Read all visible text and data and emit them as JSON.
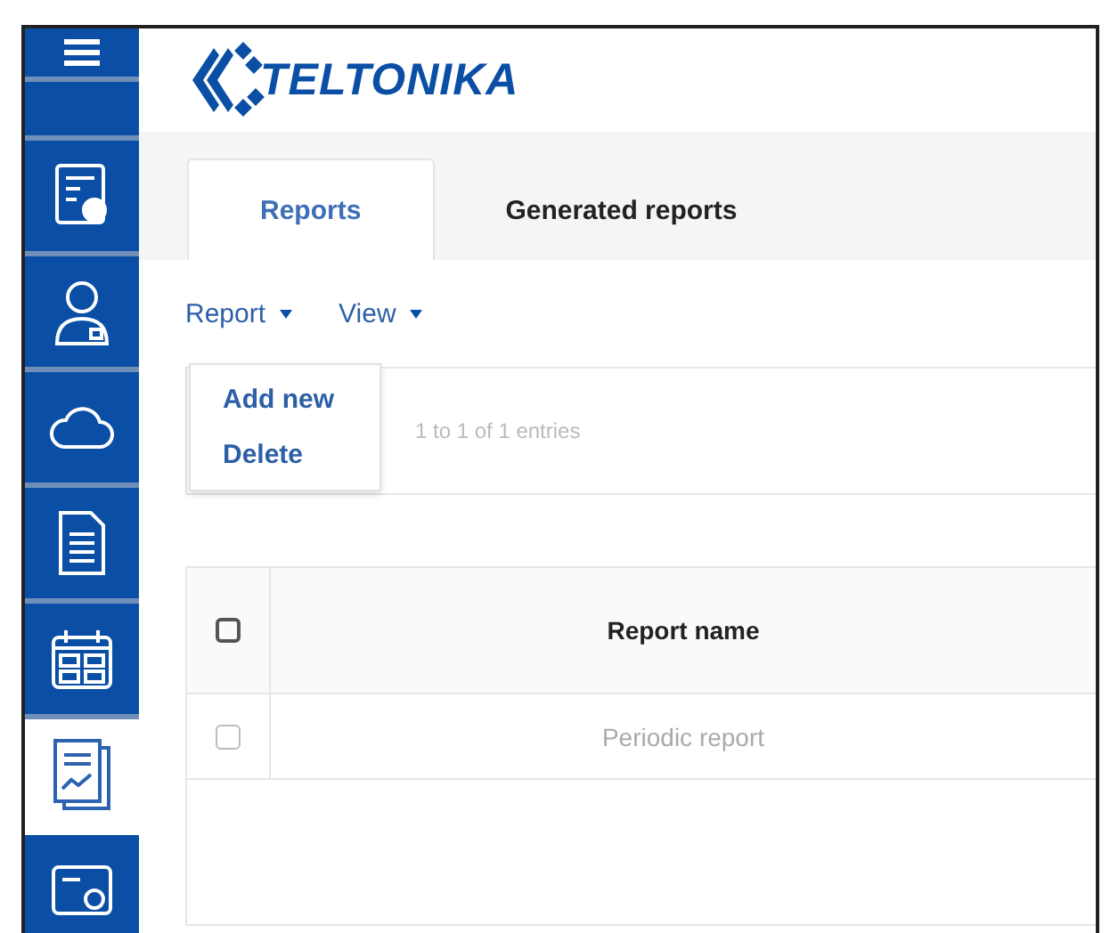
{
  "brand": {
    "name": "TELTONIKA"
  },
  "sidebar": {
    "items": [
      {
        "kind": "settings",
        "selected": false
      },
      {
        "kind": "user",
        "selected": false
      },
      {
        "kind": "cloud",
        "selected": false
      },
      {
        "kind": "document",
        "selected": false
      },
      {
        "kind": "calendar",
        "selected": false
      },
      {
        "kind": "report",
        "selected": true
      },
      {
        "kind": "card",
        "selected": false
      }
    ]
  },
  "tabs": [
    {
      "label": "Reports",
      "selected": true
    },
    {
      "label": "Generated reports",
      "selected": false
    }
  ],
  "toolbar": {
    "menus": [
      {
        "label": "Report",
        "open_items": [
          "Add new",
          "Delete"
        ]
      },
      {
        "label": "View"
      }
    ]
  },
  "info": {
    "text": "1 to 1 of 1 entries"
  },
  "table": {
    "header_checkbox": {
      "checked": false
    },
    "columns": [
      "Report name"
    ],
    "rows": [
      {
        "checked": false,
        "cells": [
          "Periodic report"
        ]
      }
    ]
  }
}
